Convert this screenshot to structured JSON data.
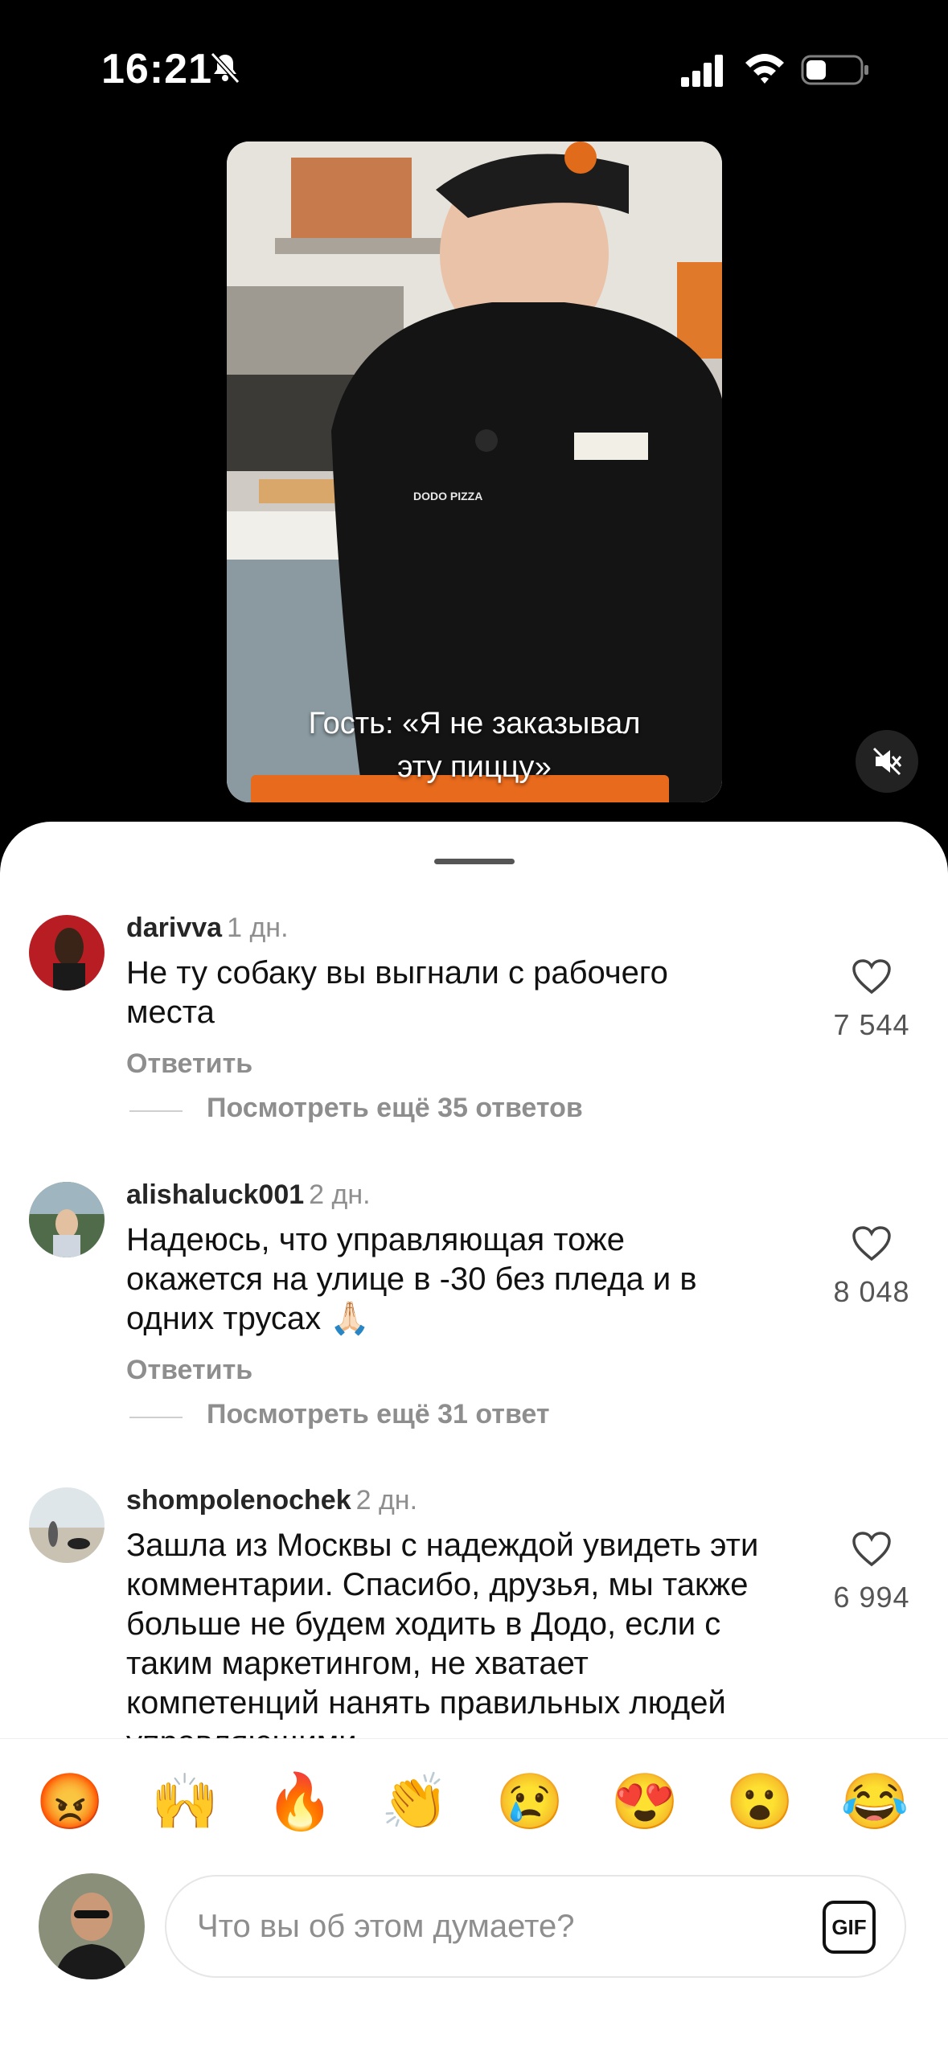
{
  "status_bar": {
    "time": "16:21"
  },
  "video": {
    "caption_line1": "Гость: «Я не заказывал",
    "caption_line2": "эту пиццу»",
    "shirt_text": "DODO PIZZA"
  },
  "comments": [
    {
      "username": "darivva",
      "time": "1 дн.",
      "text": "Не ту собаку вы выгнали с рабочего места",
      "reply_label": "Ответить",
      "more_replies": "Посмотреть ещё 35 ответов",
      "likes": "7 544"
    },
    {
      "username": "alishaluck001",
      "time": "2 дн.",
      "text": "Надеюсь, что управляющая тоже окажется на улице в -30 без пледа и в одних трусах 🙏🏻",
      "reply_label": "Ответить",
      "more_replies": "Посмотреть ещё 31 ответ",
      "likes": "8 048"
    },
    {
      "username": "shompolenochek",
      "time": "2 дн.",
      "text": "Зашла из Москвы с надеждой увидеть эти комментарии. Спасибо, друзья, мы также больше не будем ходить в Додо, если с таким маркетингом, не хватает компетенций нанять правильных людей управляющими",
      "likes": "6 994"
    }
  ],
  "emoji_reactions": [
    "😡",
    "🙌",
    "🔥",
    "👏",
    "😢",
    "😍",
    "😮",
    "😂"
  ],
  "composer": {
    "placeholder": "Что вы об этом думаете?",
    "gif_label": "GIF"
  }
}
